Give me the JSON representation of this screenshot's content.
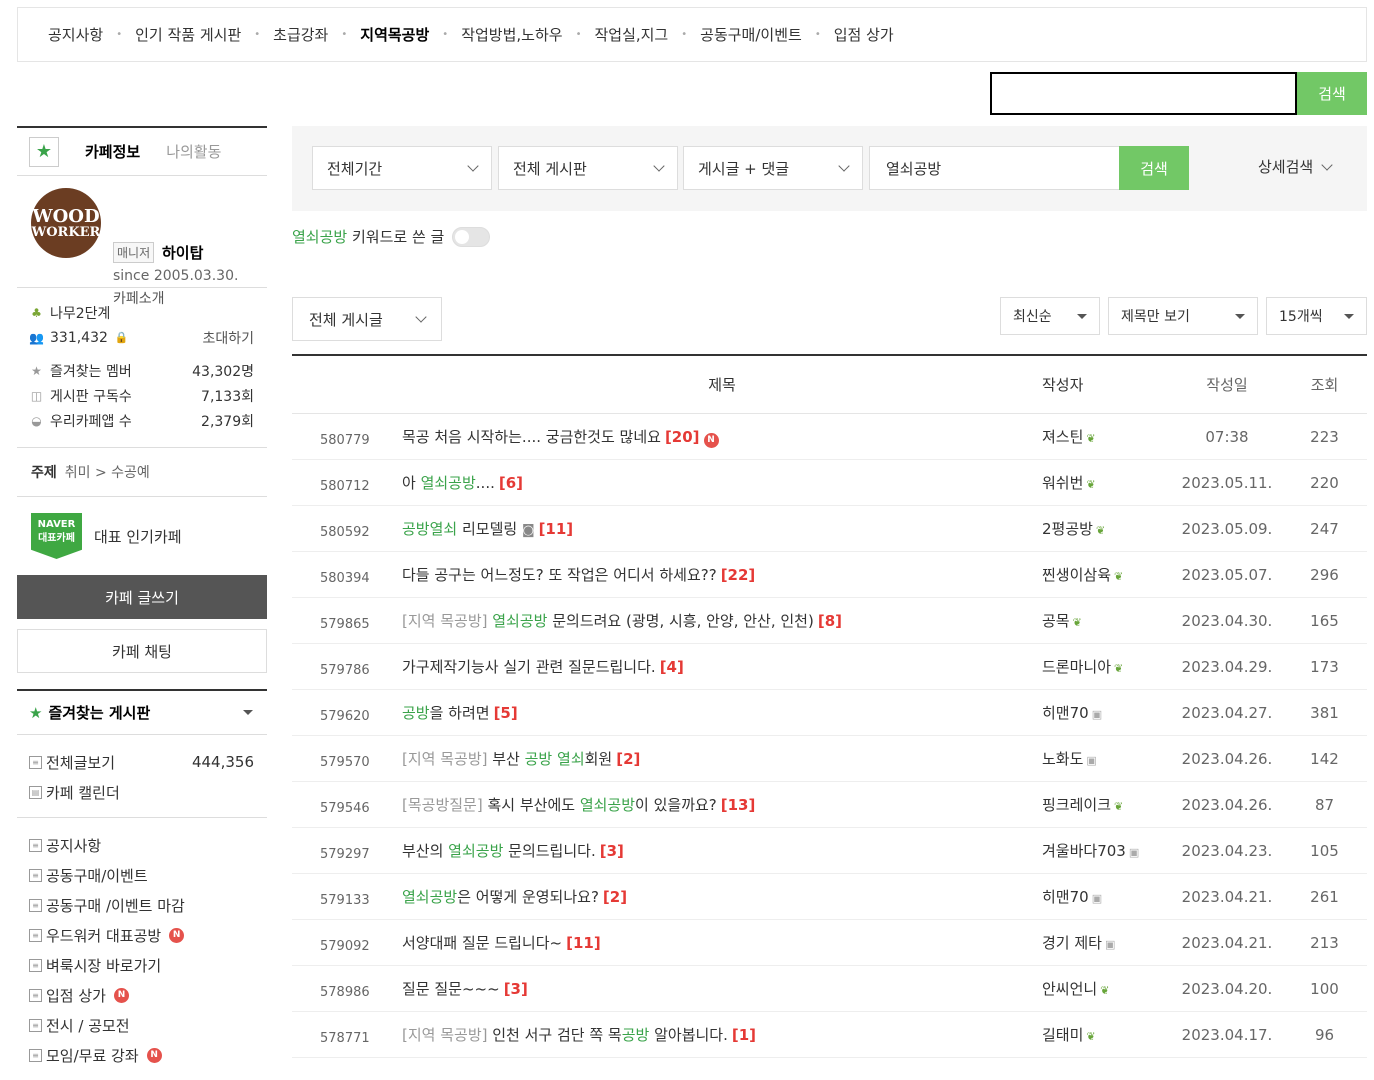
{
  "nav": [
    "공지사항",
    "인기 작품 게시판",
    "초급강좌",
    "지역목공방",
    "작업방법,노하우",
    "작업실,지그",
    "공동구매/이벤트",
    "입점 상가"
  ],
  "nav_active": 3,
  "global_search": {
    "value": "",
    "button": "검색"
  },
  "sidebar": {
    "tab_info": "카페정보",
    "tab_activity": "나의활동",
    "logo_line1": "WOOD",
    "logo_line2": "WORKER",
    "manager_label": "매니저",
    "manager_name": "하이탑",
    "since": "since 2005.03.30.",
    "intro": "카페소개",
    "level": "나무2단계",
    "members": "331,432",
    "invite": "초대하기",
    "fav_member_label": "즐겨찾는 멤버",
    "fav_member_count": "43,302명",
    "board_sub_label": "게시판 구독수",
    "board_sub_count": "7,133회",
    "app_label": "우리카페앱 수",
    "app_count": "2,379회",
    "topic_label": "주제",
    "topic_value": "취미 > 수공예",
    "naver_badge_line1": "NAVER",
    "naver_badge_line2": "대표카페",
    "naver_text": "대표 인기카페",
    "write_button": "카페 글쓰기",
    "chat_button": "카페 채팅",
    "fav_board_title": "즐겨찾는 게시판",
    "all_posts_label": "전체글보기",
    "all_posts_count": "444,356",
    "calendar_label": "카페 캘린더",
    "boards": [
      {
        "label": "공지사항",
        "new": false
      },
      {
        "label": "공동구매/이벤트",
        "new": false
      },
      {
        "label": "공동구매 /이벤트 마감",
        "new": false
      },
      {
        "label": "우드워커 대표공방",
        "new": true
      },
      {
        "label": "벼룩시장 바로가기",
        "new": false
      },
      {
        "label": "입점 상가",
        "new": true
      },
      {
        "label": "전시 / 공모전",
        "new": false
      },
      {
        "label": "모임/무료 강좌",
        "new": true
      }
    ]
  },
  "search_bar": {
    "period": "전체기간",
    "board": "전체 게시판",
    "scope": "게시글 + 댓글",
    "keyword": "열쇠공방",
    "button": "검색",
    "advanced": "상세검색"
  },
  "keyword_filter": {
    "keyword": "열쇠공방",
    "suffix": " 키워드로 쓴 글"
  },
  "filters": {
    "all_posts": "전체 게시글",
    "sort": "최신순",
    "view": "제목만 보기",
    "per_page": "15개씩"
  },
  "table": {
    "headers": {
      "title": "제목",
      "author": "작성자",
      "date": "작성일",
      "views": "조회"
    },
    "rows": [
      {
        "num": "580779",
        "parts": [
          {
            "t": "목공 처음 시작하는.... 궁금한것도 많네요",
            "c": ""
          }
        ],
        "comments": "[20]",
        "new": true,
        "author": "져스틴",
        "lv": "g",
        "date": "07:38",
        "views": "223"
      },
      {
        "num": "580712",
        "parts": [
          {
            "t": "아 ",
            "c": ""
          },
          {
            "t": "열쇠공방",
            "c": "hl"
          },
          {
            "t": "....",
            "c": ""
          }
        ],
        "comments": "[6]",
        "new": false,
        "author": "워쉬번",
        "lv": "g",
        "date": "2023.05.11.",
        "views": "220"
      },
      {
        "num": "580592",
        "parts": [
          {
            "t": "공방열쇠",
            "c": "hl"
          },
          {
            "t": " 리모델링 ",
            "c": ""
          },
          {
            "t": "◙",
            "c": "emo"
          }
        ],
        "comments": "[11]",
        "new": false,
        "author": "2평공방",
        "lv": "g",
        "date": "2023.05.09.",
        "views": "247"
      },
      {
        "num": "580394",
        "parts": [
          {
            "t": "다들 공구는 어느정도? 또 작업은 어디서 하세요??",
            "c": ""
          }
        ],
        "comments": "[22]",
        "new": false,
        "author": "찐생이삼육",
        "lv": "g",
        "date": "2023.05.07.",
        "views": "296"
      },
      {
        "num": "579865",
        "parts": [
          {
            "t": "[지역 목공방] ",
            "c": "prefix"
          },
          {
            "t": "열쇠공방",
            "c": "hl"
          },
          {
            "t": " 문의드려요 (광명, 시흥, 안양, 안산, 인천)",
            "c": ""
          }
        ],
        "comments": "[8]",
        "new": false,
        "author": "공목",
        "lv": "g",
        "date": "2023.04.30.",
        "views": "165"
      },
      {
        "num": "579786",
        "parts": [
          {
            "t": "가구제작기능사 실기 관련 질문드립니다.",
            "c": ""
          }
        ],
        "comments": "[4]",
        "new": false,
        "author": "드론마니아",
        "lv": "g",
        "date": "2023.04.29.",
        "views": "173"
      },
      {
        "num": "579620",
        "parts": [
          {
            "t": "공방",
            "c": "hl"
          },
          {
            "t": "을 하려면",
            "c": ""
          }
        ],
        "comments": "[5]",
        "new": false,
        "author": "히맨70",
        "lv": "n",
        "date": "2023.04.27.",
        "views": "381"
      },
      {
        "num": "579570",
        "parts": [
          {
            "t": "[지역 목공방] ",
            "c": "prefix"
          },
          {
            "t": "부산 ",
            "c": ""
          },
          {
            "t": "공방",
            "c": "hl"
          },
          {
            "t": " ",
            "c": ""
          },
          {
            "t": "열쇠",
            "c": "hl"
          },
          {
            "t": "회원",
            "c": ""
          }
        ],
        "comments": "[2]",
        "new": false,
        "author": "노화도",
        "lv": "n",
        "date": "2023.04.26.",
        "views": "142"
      },
      {
        "num": "579546",
        "parts": [
          {
            "t": "[목공방질문] ",
            "c": "prefix"
          },
          {
            "t": "혹시 부산에도 ",
            "c": ""
          },
          {
            "t": "열쇠공방",
            "c": "hl"
          },
          {
            "t": "이 있을까요?",
            "c": ""
          }
        ],
        "comments": "[13]",
        "new": false,
        "author": "핑크레이크",
        "lv": "g",
        "date": "2023.04.26.",
        "views": "87"
      },
      {
        "num": "579297",
        "parts": [
          {
            "t": "부산의 ",
            "c": ""
          },
          {
            "t": "열쇠공방",
            "c": "hl"
          },
          {
            "t": " 문의드립니다.",
            "c": ""
          }
        ],
        "comments": "[3]",
        "new": false,
        "author": "겨울바다703",
        "lv": "n",
        "date": "2023.04.23.",
        "views": "105"
      },
      {
        "num": "579133",
        "parts": [
          {
            "t": "열쇠공방",
            "c": "hl"
          },
          {
            "t": "은 어떻게 운영되나요?",
            "c": ""
          }
        ],
        "comments": "[2]",
        "new": false,
        "author": "히맨70",
        "lv": "n",
        "date": "2023.04.21.",
        "views": "261"
      },
      {
        "num": "579092",
        "parts": [
          {
            "t": "서양대패 질문 드립니다~",
            "c": ""
          }
        ],
        "comments": "[11]",
        "new": false,
        "author": "경기 제타",
        "lv": "n",
        "date": "2023.04.21.",
        "views": "213"
      },
      {
        "num": "578986",
        "parts": [
          {
            "t": "질문 질문~~~",
            "c": ""
          }
        ],
        "comments": "[3]",
        "new": false,
        "author": "안씨언니",
        "lv": "g",
        "date": "2023.04.20.",
        "views": "100"
      },
      {
        "num": "578771",
        "parts": [
          {
            "t": "[지역 목공방] ",
            "c": "prefix"
          },
          {
            "t": "인천 서구 검단 쪽 목",
            "c": ""
          },
          {
            "t": "공방",
            "c": "hl"
          },
          {
            "t": " 알아봅니다.",
            "c": ""
          }
        ],
        "comments": "[1]",
        "new": false,
        "author": "길태미",
        "lv": "g",
        "date": "2023.04.17.",
        "views": "96"
      }
    ]
  }
}
